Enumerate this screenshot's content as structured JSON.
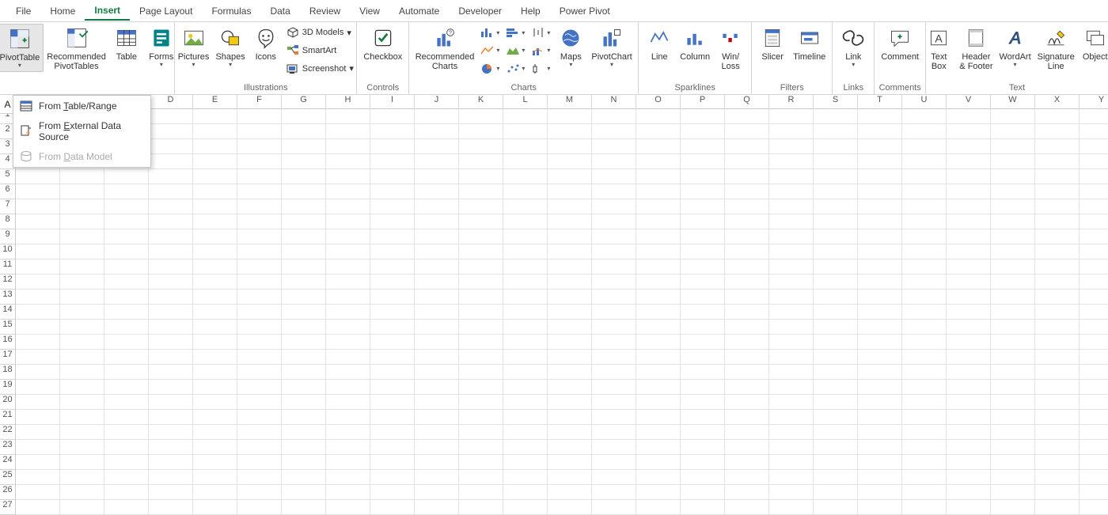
{
  "menu_tabs": [
    "File",
    "Home",
    "Insert",
    "Page Layout",
    "Formulas",
    "Data",
    "Review",
    "View",
    "Automate",
    "Developer",
    "Help",
    "Power Pivot"
  ],
  "active_tab_index": 2,
  "ribbon": {
    "tables": {
      "label": "",
      "pivot_table": "PivotTable",
      "recommended_pivots": "Recommended\nPivotTables",
      "table": "Table",
      "forms": "Forms"
    },
    "illustrations": {
      "label": "Illustrations",
      "pictures": "Pictures",
      "shapes": "Shapes",
      "icons": "Icons",
      "models": "3D Models",
      "smartart": "SmartArt",
      "screenshot": "Screenshot"
    },
    "controls": {
      "label": "Controls",
      "checkbox": "Checkbox"
    },
    "charts": {
      "label": "Charts",
      "recommended": "Recommended\nCharts",
      "maps": "Maps",
      "pivot_chart": "PivotChart"
    },
    "sparklines": {
      "label": "Sparklines",
      "line": "Line",
      "column": "Column",
      "winloss": "Win/\nLoss"
    },
    "filters": {
      "label": "Filters",
      "slicer": "Slicer",
      "timeline": "Timeline"
    },
    "links": {
      "label": "Links",
      "link": "Link"
    },
    "comments": {
      "label": "Comments",
      "comment": "Comment"
    },
    "text": {
      "label": "Text",
      "textbox": "Text\nBox",
      "header_footer": "Header\n& Footer",
      "wordart": "WordArt",
      "signature": "Signature\nLine",
      "object": "Object"
    }
  },
  "dropdown": {
    "from_table_range": "From Table/Range",
    "from_external": "From External Data Source",
    "from_data_model": "From Data Model"
  },
  "grid": {
    "namebox_value": "A",
    "columns": [
      "D",
      "E",
      "F",
      "G",
      "H",
      "I",
      "J",
      "K",
      "L",
      "M",
      "N",
      "O",
      "P",
      "Q",
      "R",
      "S",
      "T",
      "U",
      "V",
      "W",
      "X",
      "Y"
    ],
    "rows": [
      1,
      2,
      3,
      4,
      5,
      6,
      7,
      8,
      9,
      10,
      11,
      12,
      13,
      14,
      15,
      16,
      17,
      18,
      19,
      20,
      21,
      22,
      23,
      24,
      25,
      26,
      27
    ],
    "selected": {
      "row": 1,
      "col": "A"
    }
  },
  "caret": "▾"
}
